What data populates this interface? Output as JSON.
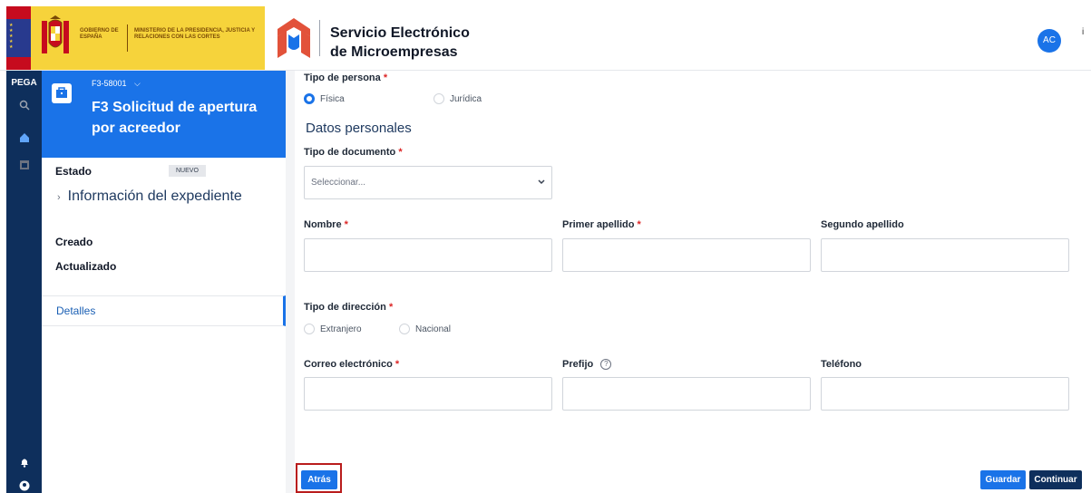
{
  "header": {
    "gov_line1": "GOBIERNO DE ESPAÑA",
    "gov_line2": "MINISTERIO DE LA PRESIDENCIA, JUSTICIA Y RELACIONES CON LAS CORTES",
    "app_title_line1": "Servicio Electrónico",
    "app_title_line2": "de Microempresas",
    "avatar": "AC",
    "info": "i"
  },
  "rail": {
    "logo": "PEGA",
    "icons": [
      "search-icon",
      "home-icon",
      "calendar-icon",
      "bell-icon",
      "user-icon"
    ]
  },
  "case": {
    "id": "F3-58001",
    "title": "F3 Solicitud de apertura por acreedor",
    "estado_label": "Estado",
    "estado_value": "NUEVO",
    "info_link": "Información del expediente",
    "creado_label": "Creado",
    "actualizado_label": "Actualizado",
    "details_tab": "Detalles"
  },
  "form": {
    "tipo_persona_label": "Tipo de persona",
    "tipo_persona_options": [
      "Física",
      "Jurídica"
    ],
    "tipo_persona_selected": "Física",
    "section_title": "Datos personales",
    "tipo_documento_label": "Tipo de documento",
    "tipo_documento_placeholder": "Seleccionar...",
    "nombre_label": "Nombre",
    "primer_apellido_label": "Primer apellido",
    "segundo_apellido_label": "Segundo apellido",
    "tipo_direccion_label": "Tipo de dirección",
    "tipo_direccion_options": [
      "Extranjero",
      "Nacional"
    ],
    "correo_label": "Correo electrónico",
    "prefijo_label": "Prefijo",
    "telefono_label": "Teléfono",
    "required_mark": "*",
    "help_mark": "?"
  },
  "actions": {
    "back": "Atrás",
    "save": "Guardar",
    "continue": "Continuar"
  },
  "colors": {
    "primary": "#1a73e8",
    "dark_nav": "#0e2f5c",
    "gov_yellow": "#f6d33b",
    "required": "#dc2626",
    "highlight": "#b91c1c"
  }
}
